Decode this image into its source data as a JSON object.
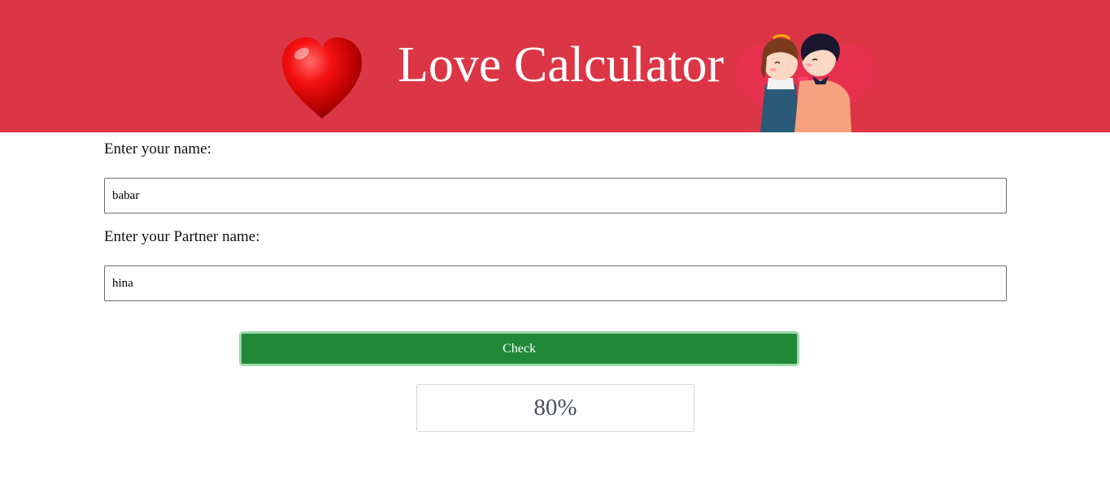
{
  "header": {
    "title": "Love Calculator",
    "background_color": "#dc3545",
    "left_icon": "heart-icon",
    "right_image": "couple-kissing-illustration"
  },
  "form": {
    "name_label": "Enter your name:",
    "name_value": "babar",
    "partner_label": "Enter your Partner name:",
    "partner_value": "hina",
    "check_label": "Check",
    "check_color": "#218838"
  },
  "result": {
    "value": "80%"
  }
}
